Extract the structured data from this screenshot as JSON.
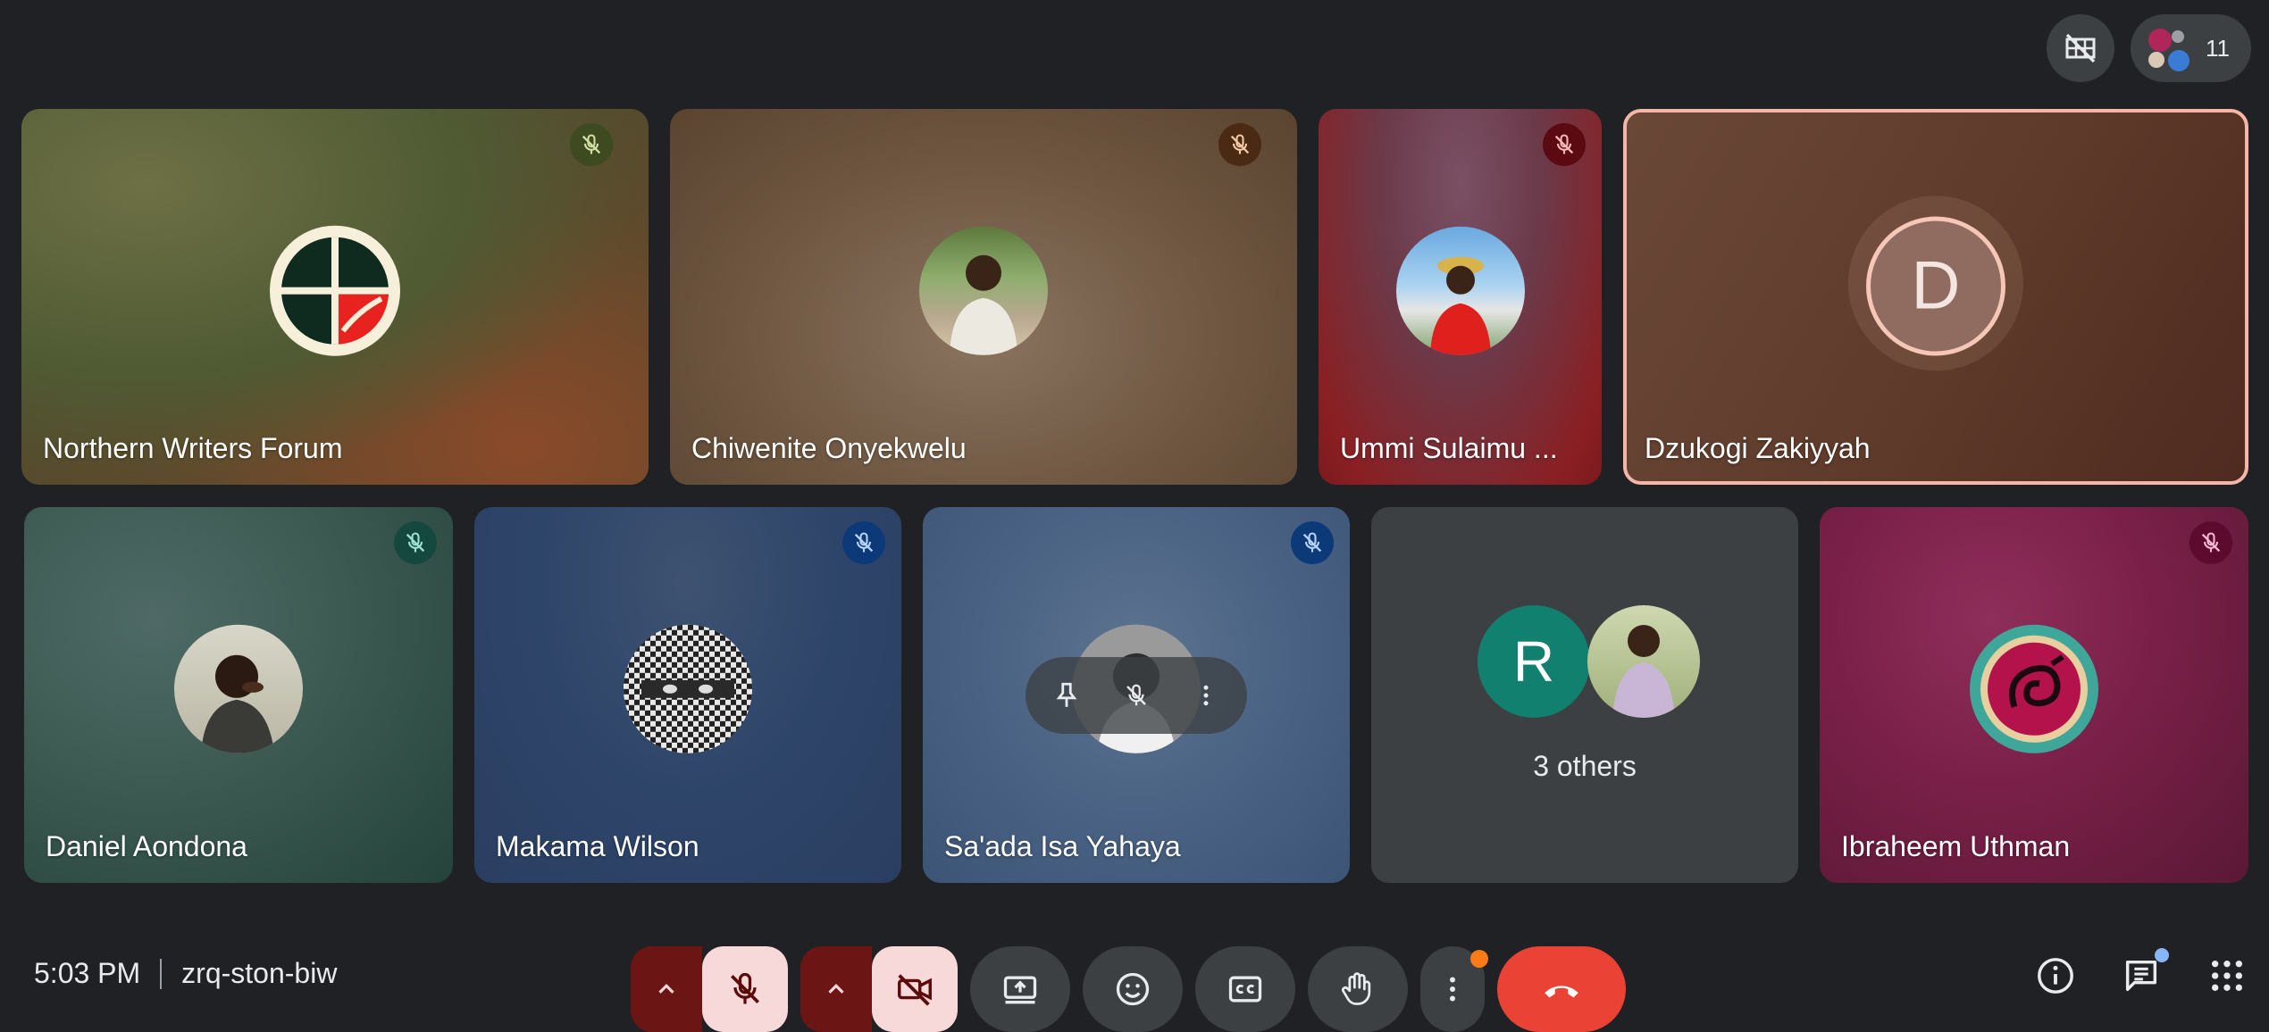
{
  "header": {
    "participant_count": "11"
  },
  "tiles": [
    {
      "name": "Northern Writers Forum",
      "muted": true
    },
    {
      "name": "Chiwenite Onyekwelu",
      "muted": true
    },
    {
      "name": "Ummi Sulaimu ...",
      "muted": true
    },
    {
      "name": "Dzukogi Zakiyyah",
      "initial": "D",
      "speaking": true
    },
    {
      "name": "Daniel Aondona",
      "muted": true
    },
    {
      "name": "Makama Wilson",
      "muted": true
    },
    {
      "name": "Sa'ada Isa Yahaya",
      "muted": true
    },
    {
      "others_label": "3 others",
      "initial": "R"
    },
    {
      "name": "Ibraheem Uthman",
      "muted": true
    }
  ],
  "footer": {
    "time": "5:03 PM",
    "meeting_code": "zrq-ston-biw"
  },
  "colors": {
    "background": "#202124",
    "control": "#3c4043",
    "end_call": "#ea4335",
    "speaking_border": "#f4b6a6",
    "notification_dot": "#fa7b17",
    "chat_dot": "#8ab4f8"
  },
  "icons": [
    "hide-tiles-icon",
    "participants-icon",
    "mic-off-icon",
    "camera-off-icon",
    "present-icon",
    "emoji-icon",
    "captions-icon",
    "raise-hand-icon",
    "more-icon",
    "end-call-icon",
    "info-icon",
    "chat-icon",
    "activities-icon",
    "pin-icon"
  ]
}
